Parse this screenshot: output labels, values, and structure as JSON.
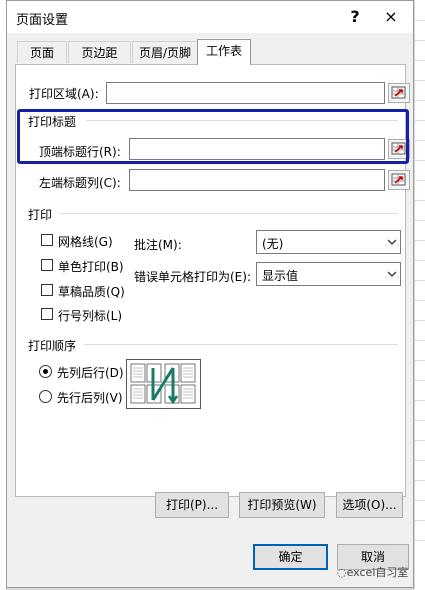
{
  "dialog": {
    "title": "页面设置",
    "help": "?",
    "close": "×"
  },
  "tabs": [
    "页面",
    "页边距",
    "页眉/页脚",
    "工作表"
  ],
  "print_area": {
    "label": "打印区域(A):",
    "value": ""
  },
  "print_titles": {
    "section": "打印标题",
    "rows_label": "顶端标题行(R):",
    "rows_value": "",
    "cols_label": "左端标题列(C):",
    "cols_value": ""
  },
  "print": {
    "section": "打印",
    "gridlines": "网格线(G)",
    "bw": "单色打印(B)",
    "draft": "草稿品质(Q)",
    "headings": "行号列标(L)",
    "comments_label": "批注(M):",
    "comments_value": "(无)",
    "errors_label": "错误单元格打印为(E):",
    "errors_value": "显示值"
  },
  "order": {
    "section": "打印顺序",
    "down_then_over": "先列后行(D)",
    "over_then_down": "先行后列(V)",
    "selected": "down_then_over"
  },
  "buttons": {
    "print": "打印(P)...",
    "preview": "打印预览(W)",
    "options": "选项(O)...",
    "ok": "确定",
    "cancel": "取消"
  },
  "watermark": "excel自习室"
}
